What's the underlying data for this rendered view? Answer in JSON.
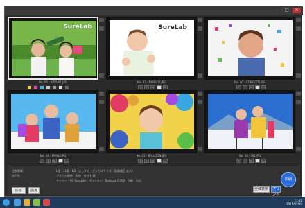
{
  "window": {
    "min": "–",
    "max": "□",
    "close": "×"
  },
  "photos": [
    {
      "filename": "No. 01 · KIDS-01.JPG",
      "logo": "SureLab",
      "selected": true
    },
    {
      "filename": "No. 02 · BABY-02.JPG",
      "logo": "SureLab",
      "selected": false
    },
    {
      "filename": "No. 03 · CONFETTI.JPG",
      "logo": "",
      "selected": false
    },
    {
      "filename": "No. 04 · FAMILY.JPG",
      "logo": "",
      "selected": false
    },
    {
      "filename": "No. 05 · BALLOON.JPG",
      "logo": "",
      "selected": false
    },
    {
      "filename": "No. 06 · SKI.JPG",
      "logo": "",
      "selected": false
    }
  ],
  "bottom": {
    "label1": "注文情報",
    "label2": "出力先",
    "info1": "L版 · 2L版 · KG · ましかく · デジカメサイズ（画像補正 あり）",
    "info2": "プリント枚数：6 枚 · 合計 6 枚",
    "info3": "サーバー：PC-SureLab · プリンター：SureLab D700 · 用紙：光沢",
    "back_btn": "戻る",
    "opt_btn": "設定",
    "fit_btn": "全体表示",
    "print_btn": "印刷",
    "print_btn2": "プリント"
  },
  "taskbar": {
    "time": "11:22",
    "date": "2015/03/10"
  }
}
